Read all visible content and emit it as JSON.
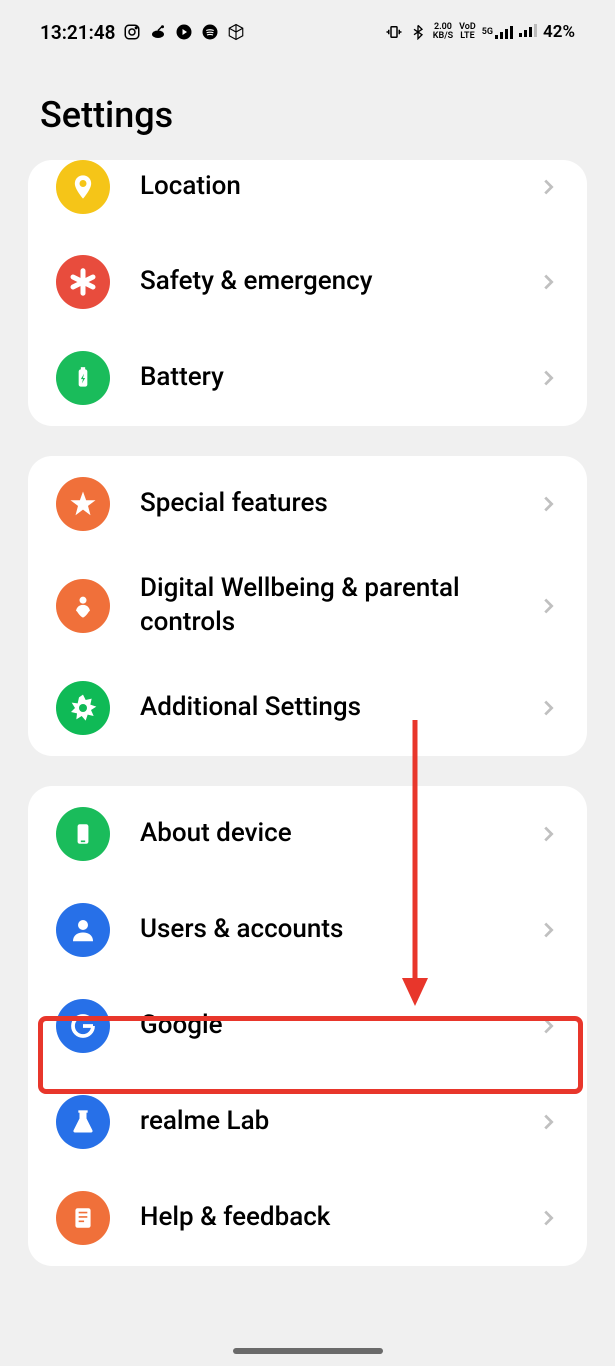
{
  "status": {
    "time": "13:21:48",
    "net_speed_top": "2.00",
    "net_speed_bottom": "KB/S",
    "volte_top": "VoD",
    "volte_bottom": "LTE",
    "signal_label": "5G",
    "battery": "42%"
  },
  "header": {
    "title": "Settings"
  },
  "groups": [
    {
      "items": [
        {
          "id": "location",
          "label": "Location",
          "icon": "location-icon",
          "bg": "bg-yellow",
          "cut": true
        },
        {
          "id": "safety",
          "label": "Safety & emergency",
          "icon": "asterisk-icon",
          "bg": "bg-red"
        },
        {
          "id": "battery",
          "label": "Battery",
          "icon": "battery-icon",
          "bg": "bg-green"
        }
      ]
    },
    {
      "items": [
        {
          "id": "special-features",
          "label": "Special features",
          "icon": "star-icon",
          "bg": "bg-orange"
        },
        {
          "id": "wellbeing",
          "label": "Digital Wellbeing & parental controls",
          "icon": "heart-person-icon",
          "bg": "bg-orange"
        },
        {
          "id": "additional",
          "label": "Additional Settings",
          "icon": "gear-star-icon",
          "bg": "bg-green2"
        }
      ]
    },
    {
      "items": [
        {
          "id": "about-device",
          "label": "About device",
          "icon": "phone-icon",
          "bg": "bg-green"
        },
        {
          "id": "users-accounts",
          "label": "Users & accounts",
          "icon": "person-icon",
          "bg": "bg-blue"
        },
        {
          "id": "google",
          "label": "Google",
          "icon": "google-icon",
          "bg": "bg-blue"
        },
        {
          "id": "realme-lab",
          "label": "realme Lab",
          "icon": "flask-icon",
          "bg": "bg-blue"
        },
        {
          "id": "help",
          "label": "Help & feedback",
          "icon": "book-icon",
          "bg": "bg-orange"
        }
      ]
    }
  ],
  "annotation": {
    "highlight": "google"
  }
}
